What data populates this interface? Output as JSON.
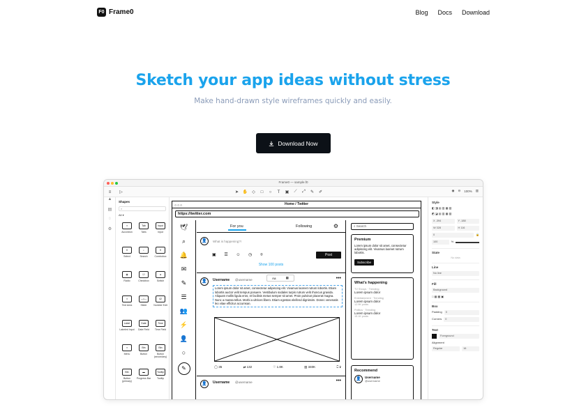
{
  "nav": {
    "brand": "Frame0",
    "logo_glyph": "F0",
    "links": [
      "Blog",
      "Docs",
      "Download"
    ]
  },
  "hero": {
    "title": "Sketch your app ideas without stress",
    "subtitle": "Make hand-drawn style wireframes quickly and easily.",
    "cta": "Download Now"
  },
  "colors": {
    "accent": "#1aa3ec",
    "cta_bg": "#0c1117",
    "subtitle": "#8a9bb8"
  },
  "app": {
    "window_title": "Frame0 — sample.f0",
    "zoom": "100%",
    "shapes_panel": {
      "title": "Shapes",
      "filter": "All",
      "items": [
        {
          "label": "Accordion",
          "glyph": "≡"
        },
        {
          "label": "Tabs",
          "glyph": "Tab"
        },
        {
          "label": "Input",
          "glyph": "Input"
        },
        {
          "label": "Select",
          "glyph": "▾"
        },
        {
          "label": "Search",
          "glyph": "⌕"
        },
        {
          "label": "Combobox",
          "glyph": "▾"
        },
        {
          "label": "Radio",
          "glyph": "◉"
        },
        {
          "label": "Checkbox",
          "glyph": "☑"
        },
        {
          "label": "Switch",
          "glyph": "●"
        },
        {
          "label": "Text Area",
          "glyph": "≡"
        },
        {
          "label": "Slider",
          "glyph": "—•—"
        },
        {
          "label": "Number Edit",
          "glyph": "42"
        },
        {
          "label": "Labeled Input",
          "glyph": "Label"
        },
        {
          "label": "Date Field",
          "glyph": "Date"
        },
        {
          "label": "Time Field",
          "glyph": "Time"
        },
        {
          "label": "Menu",
          "glyph": "≡"
        },
        {
          "label": "Button",
          "glyph": "Btn"
        },
        {
          "label": "Button (secondary)",
          "glyph": "Btn"
        },
        {
          "label": "Button (primary)",
          "glyph": "Btn"
        },
        {
          "label": "Progress Bar",
          "glyph": "▬"
        },
        {
          "label": "Tooltip",
          "glyph": "Tooltip"
        }
      ]
    },
    "sketch": {
      "browser_title": "Home / Twitter",
      "url": "https://twitter.com",
      "tabs": [
        "For you",
        "Following"
      ],
      "compose_placeholder": "What is happening?!",
      "compose_icons": "▣ ☰ ☺ ◷ ⌾",
      "post_button": "Post",
      "show_posts": "Show 100 posts",
      "floater": [
        "Aa",
        "▦"
      ],
      "post1": {
        "user": "Username",
        "handle": "@username",
        "text": "Lorem ipsum dolor sit amet, consectetur adipiscing elit. Vivamus laoreet rutrum lobortis. Etiam lobortis auctor velit tempus posuere. Vestibulum sodales turpis rutrum velit rhoncus gravida. Aliquam mollis ligula eros, et facilisis metus semper sit amet. Proin pulvinar placerat magna. Nunc a massa tellus. Morbi a ultrices libero. Etiam egestas eleifend dignissim. Donec venenatis leo vitae efficitur accumsan.",
        "stats": [
          "◯ 35",
          "⇄ 132",
          "♡ 1.8K",
          "▥ 340K",
          "⎕ ⇪"
        ]
      },
      "post2": {
        "user": "Username",
        "handle": "@username"
      },
      "search": "Search",
      "premium": {
        "title": "Premium",
        "text": "Lorem ipsum dolor sit amet, consectetur adipiscing elit. Vivamus laoreet rutrum lobortis.",
        "button": "Subscribe"
      },
      "happening": {
        "title": "What's happening",
        "trends": [
          {
            "cat": "TV Shows · Trending",
            "text": "Lorem ipsum dolor",
            "count": ""
          },
          {
            "cat": "Entertainment · Trending",
            "text": "Lorem ipsum dolor",
            "count": "12.9K posts"
          },
          {
            "cat": "Politics · Trending",
            "text": "Lorem ipsum dolor",
            "count": "15.1K posts"
          }
        ]
      },
      "recommend": {
        "title": "Recommend",
        "user": "Username",
        "handle": "@username"
      }
    },
    "props": {
      "style": "Style",
      "x": "X  -394",
      "y": "Y  -188",
      "w": "W  328",
      "h": "H  116",
      "rot": "0",
      "opacity": "100",
      "opacity_unit": "%",
      "state": "State",
      "state_empty": "No data",
      "line": "Line",
      "line_val": "No line",
      "fill": "Fill",
      "fill_val": "Background",
      "box": "Box",
      "padding": "Padding",
      "padding_val": "0",
      "corners": "Corners",
      "corners_val": "0",
      "text": "Text",
      "text_color": "Foreground",
      "align": "Alignment",
      "weight": "Regular",
      "size": "16"
    }
  }
}
